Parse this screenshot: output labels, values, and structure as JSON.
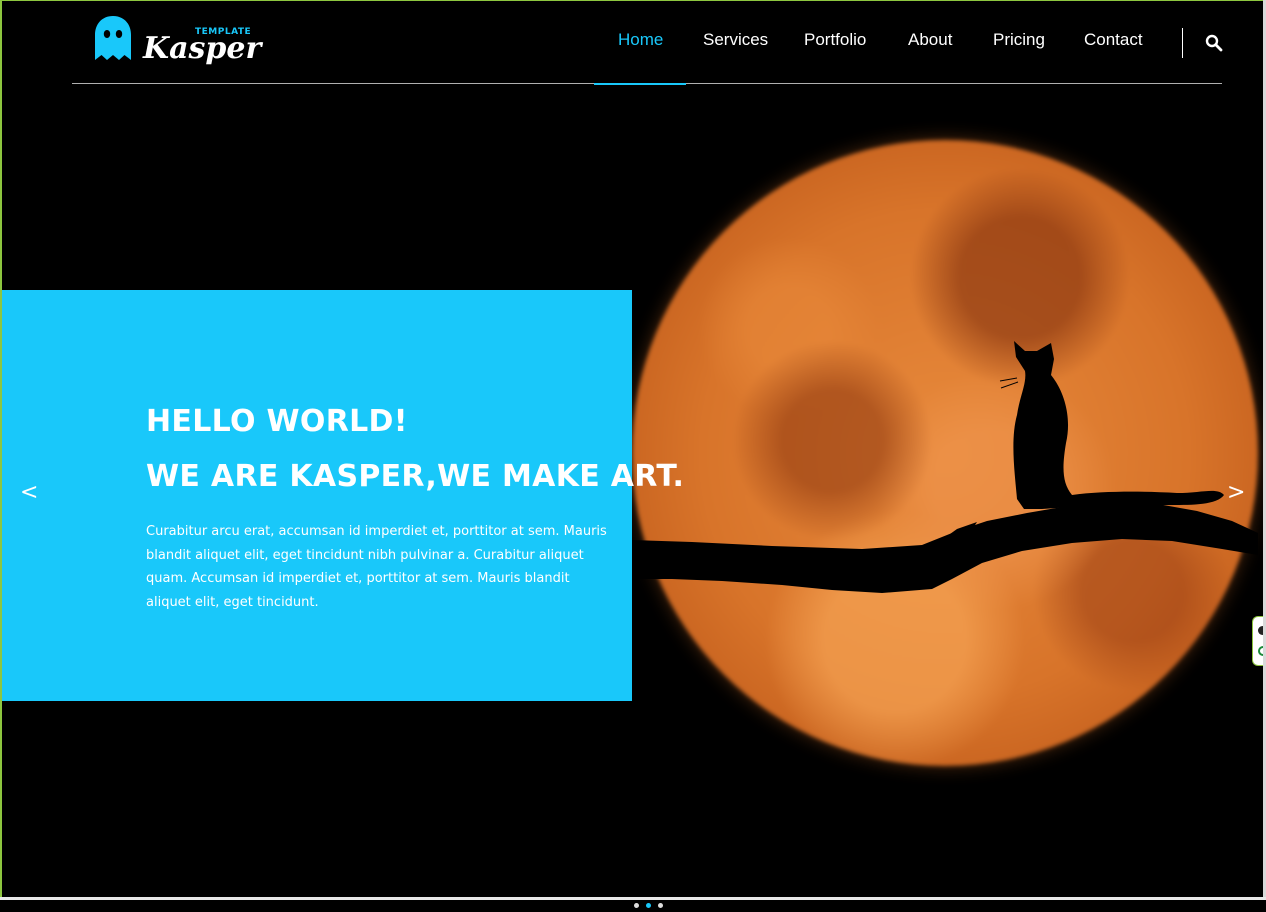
{
  "header": {
    "logo": {
      "small": "TEMPLATE",
      "word": "Kasper",
      "icon": "ghost-icon"
    },
    "nav": [
      {
        "label": "Home",
        "active": true
      },
      {
        "label": "Services",
        "active": false
      },
      {
        "label": "Portfolio",
        "active": false
      },
      {
        "label": "About",
        "active": false
      },
      {
        "label": "Pricing",
        "active": false
      },
      {
        "label": "Contact",
        "active": false
      }
    ],
    "search_icon": "search-icon"
  },
  "hero": {
    "line1": "HELLO WORLD!",
    "line2": "WE ARE KASPER,WE MAKE ART.",
    "text": "Curabitur arcu erat, accumsan id imperdiet et, porttitor at sem. Mauris blandit aliquet elit, eget tincidunt nibh pulvinar a. Curabitur aliquet quam. Accumsan id imperdiet et, porttitor at sem. Mauris blandit aliquet elit, eget tincidunt.",
    "prev_arrow": "<",
    "next_arrow": ">",
    "image": "moon-with-cat-silhouette"
  },
  "colors": {
    "accent": "#19c8fa",
    "background": "#000000",
    "moon": "#e88a3c"
  },
  "slider": {
    "dots": 3,
    "active_index": 1
  }
}
